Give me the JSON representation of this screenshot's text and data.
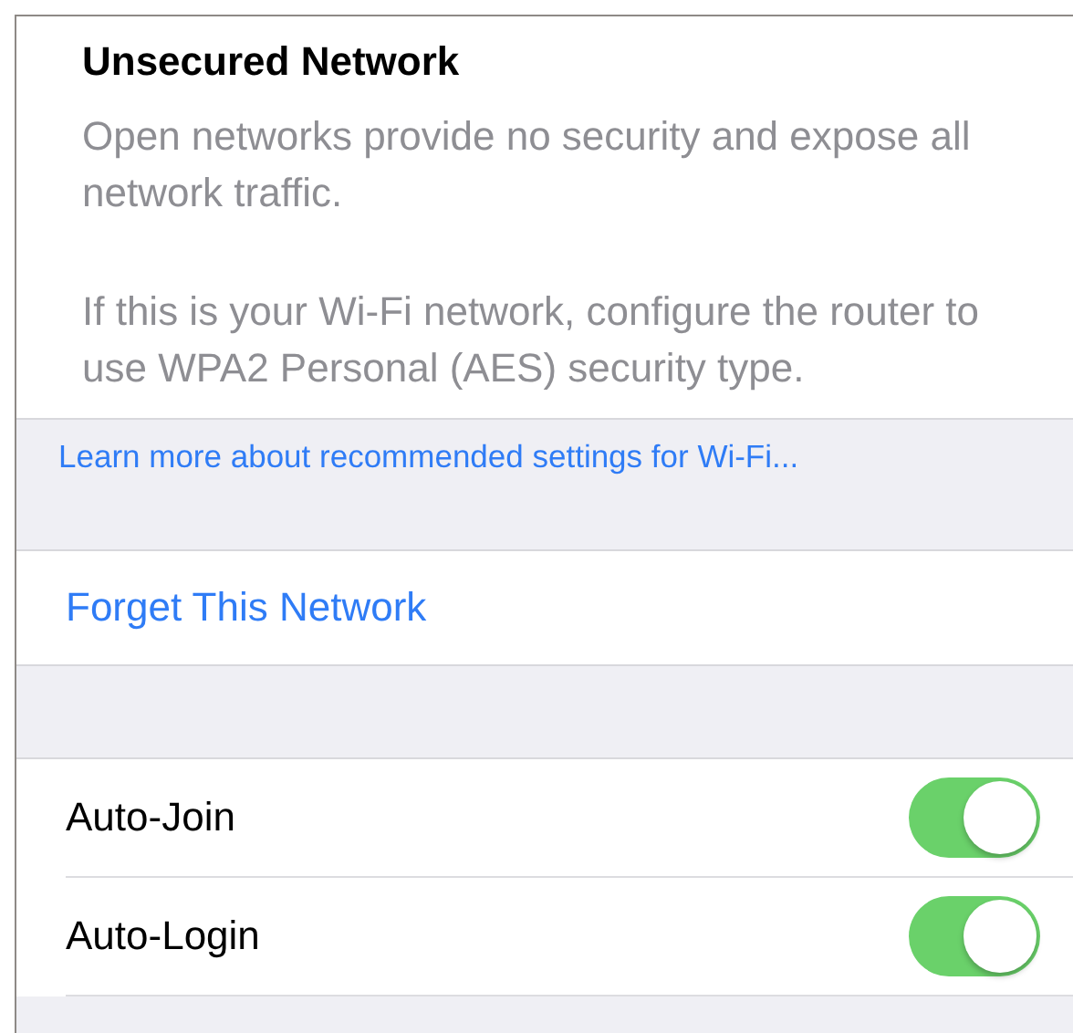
{
  "info": {
    "title": "Unsecured Network",
    "paragraphs": [
      "Open networks provide no security and expose all network traffic.",
      "If this is your Wi-Fi network, configure the router to use WPA2 Personal (AES) security type."
    ]
  },
  "link": "Learn more about recommended settings for Wi-Fi...",
  "forget_button": "Forget This Network",
  "settings": [
    {
      "label": "Auto-Join",
      "on": true
    },
    {
      "label": "Auto-Login",
      "on": true
    }
  ]
}
